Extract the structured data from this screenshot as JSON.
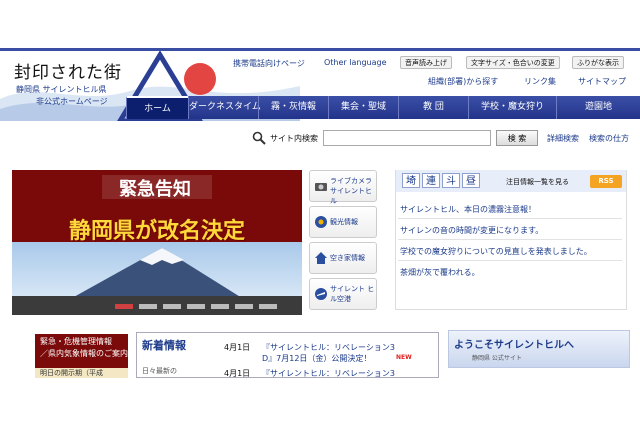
{
  "header": {
    "logo": "封印された街",
    "pref_name": "静岡県 サイレントヒル県",
    "pref_sub": "非公式ホームページ",
    "top_links": [
      "携帯電話向けページ",
      "Other language"
    ],
    "tools": [
      "音声読み上げ",
      "文字サイズ・色合いの変更",
      "ふりがな表示"
    ],
    "utility": [
      "組織(部署)から探す",
      "リンク集",
      "サイトマップ"
    ]
  },
  "nav": [
    "ホーム",
    "ダークネスタイム",
    "霧・灰情報",
    "集会・聖域",
    "教 団",
    "学校・魔女狩り",
    "遊園地"
  ],
  "search": {
    "label": "サイト内検索",
    "button": "検 索",
    "links": [
      "詳細検索",
      "検索の仕方"
    ]
  },
  "hero": {
    "banner_top": "緊急告知",
    "banner_main": "静岡県が改名決定"
  },
  "side_buttons": [
    {
      "label": "ライブカメラ サイレントヒル",
      "icon": "camera-icon"
    },
    {
      "label": "観光情報",
      "icon": "tourism-icon"
    },
    {
      "label": "空き家情報",
      "icon": "house-icon"
    },
    {
      "label": "サイレント ヒル空港",
      "icon": "airport-icon"
    }
  ],
  "news": {
    "tabs": [
      "埼",
      "連",
      "斗",
      "昼"
    ],
    "more_link": "注目情報一覧を見る",
    "rss": "RSS",
    "items": [
      "サイレントヒル、本日の濃霧注意報！",
      "サイレンの音の時間が変更になります。",
      "学校での魔女狩りについての見直しを発表しました。",
      "茶畑が灰で覆われる。"
    ]
  },
  "emergency": {
    "title": "緊急・危機管理情報",
    "subtitle": "／県内気象情報のご案内",
    "line3": "明日の開示期（平成"
  },
  "info": {
    "title": "新着情報",
    "side_text": "日々最新の",
    "rows": [
      {
        "date": "4月1日",
        "text": "『サイレントヒル：リベレーション3",
        "text2": "D』7月12日（金）公開決定！",
        "badge": "NEW"
      },
      {
        "date": "4月1日",
        "text": "『サイレントヒル：リベレーション3"
      }
    ]
  },
  "welcome": {
    "text": "ようこそサイレントヒルへ",
    "sub": "静岡県 公式サイト"
  },
  "colors": {
    "nav": "#22348a",
    "link": "#1b3a8a",
    "emergency": "#7b0a0a",
    "rss": "#f5a323"
  }
}
